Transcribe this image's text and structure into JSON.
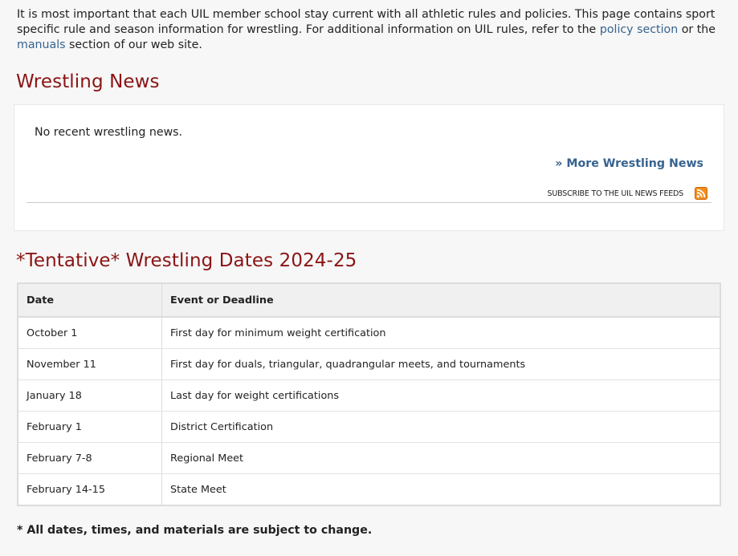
{
  "intro": {
    "text_before": "It is most important that each UIL member school stay current with all athletic rules and policies. This page contains sport specific rule and season information for wrestling. For additional information on UIL rules, refer to the ",
    "policy_link": "policy section",
    "text_middle": " or the ",
    "manuals_link": "manuals",
    "text_after": " section of our web site."
  },
  "news": {
    "title": "Wrestling News",
    "empty_message": "No recent wrestling news.",
    "more_link": "» More Wrestling News",
    "subscribe_text": "SUBSCRIBE TO THE UIL NEWS FEEDS",
    "rss_icon": "rss-feed-icon"
  },
  "dates": {
    "title": "*Tentative* Wrestling Dates 2024-25",
    "columns": [
      "Date",
      "Event or Deadline"
    ],
    "rows": [
      {
        "date": "October 1",
        "event": "First day for minimum weight certification"
      },
      {
        "date": "November 11",
        "event": "First day for duals, triangular, quadrangular meets, and tournaments"
      },
      {
        "date": "January 18",
        "event": "Last day for weight certifications"
      },
      {
        "date": "February 1",
        "event": "District Certification"
      },
      {
        "date": "February 7-8",
        "event": "Regional Meet"
      },
      {
        "date": "February 14-15",
        "event": "State Meet"
      }
    ]
  },
  "footnote": "* All dates, times, and materials are subject to change.",
  "colors": {
    "heading": "#8b1414",
    "link": "#36638f",
    "rss": "#f28c1e"
  }
}
